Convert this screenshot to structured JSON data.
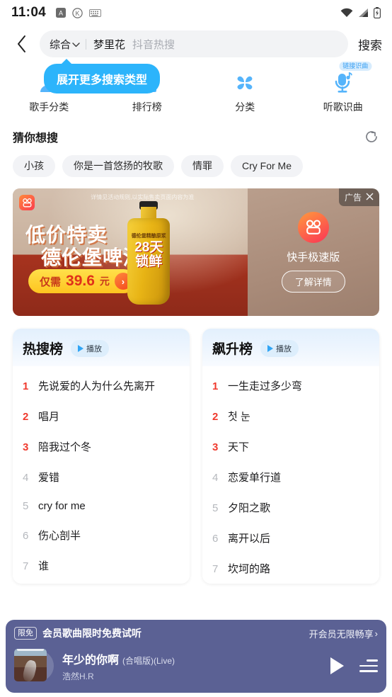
{
  "status_bar": {
    "time": "11:04",
    "left_icons": [
      "app-icon",
      "k-circle-icon",
      "keyboard-icon"
    ],
    "right_icons": [
      "wifi-icon",
      "signal-icon",
      "battery-icon"
    ]
  },
  "header": {
    "back_icon": "back-chevron-icon",
    "scope_label": "综合",
    "scope_caret": "⌄",
    "query_value": "梦里花",
    "query_placeholder": "抖音热搜",
    "search_button": "搜索"
  },
  "tooltip": {
    "text": "展开更多搜索类型"
  },
  "quick_entries": [
    {
      "label": "歌手分类",
      "icon": "singer-category-icon",
      "badge": ""
    },
    {
      "label": "排行榜",
      "icon": "ranking-chart-icon",
      "badge": ""
    },
    {
      "label": "分类",
      "icon": "category-clover-icon",
      "badge": ""
    },
    {
      "label": "听歌识曲",
      "icon": "song-recognize-mic-icon",
      "badge": "链接识曲"
    }
  ],
  "guess": {
    "title": "猜你想搜",
    "refresh_icon": "refresh-icon",
    "chips": [
      "小孩",
      "你是一首悠扬的牧歌",
      "情罪",
      "Cry For Me"
    ]
  },
  "ad": {
    "tag_label": "广告",
    "close_icon": "close-icon",
    "disclaimer": "详情见活动规则,以实际售卖页面内容为准",
    "brand_icon": "kuaishou-logo-icon",
    "headline_1": "低价特卖",
    "headline_2": "德伦堡啤酒",
    "price_prefix": "仅需",
    "price_value": "39.6",
    "price_unit": "元",
    "price_arrow": "›",
    "bottle_brand": "德伦堡精酿原浆",
    "bottle_line_1": "28天",
    "bottle_line_2": "锁鲜",
    "app_name": "快手极速版",
    "cta": "了解详情"
  },
  "rank_cards": [
    {
      "title": "热搜榜",
      "play_label": "播放",
      "items": [
        {
          "rank": "1",
          "name": "先说爱的人为什么先离开"
        },
        {
          "rank": "2",
          "name": "唱月"
        },
        {
          "rank": "3",
          "name": "陪我过个冬"
        },
        {
          "rank": "4",
          "name": "爱错"
        },
        {
          "rank": "5",
          "name": "cry for me"
        },
        {
          "rank": "6",
          "name": "伤心剖半"
        },
        {
          "rank": "7",
          "name": "谁"
        }
      ]
    },
    {
      "title": "飙升榜",
      "play_label": "播放",
      "items": [
        {
          "rank": "1",
          "name": "一生走过多少弯"
        },
        {
          "rank": "2",
          "name": "첫 눈"
        },
        {
          "rank": "3",
          "name": "天下"
        },
        {
          "rank": "4",
          "name": "恋爱单行道"
        },
        {
          "rank": "5",
          "name": "夕阳之歌"
        },
        {
          "rank": "6",
          "name": "离开以后"
        },
        {
          "rank": "7",
          "name": "坎坷的路"
        }
      ]
    }
  ],
  "player": {
    "promo_badge": "限免",
    "promo_text": "会员歌曲限时免费试听",
    "promo_link": "开会员无限畅享",
    "promo_link_caret": "›",
    "track_title": "年少的你啊",
    "track_version": "(合唱版)(Live)",
    "track_artist": "浩然H.R",
    "play_icon": "play-icon",
    "queue_icon": "playlist-queue-icon"
  },
  "colors": {
    "accent_blue": "#2cb4fb",
    "rank_red": "#f03a2e",
    "player_bg": "#5b6194",
    "chip_bg": "#f2f3f6"
  }
}
